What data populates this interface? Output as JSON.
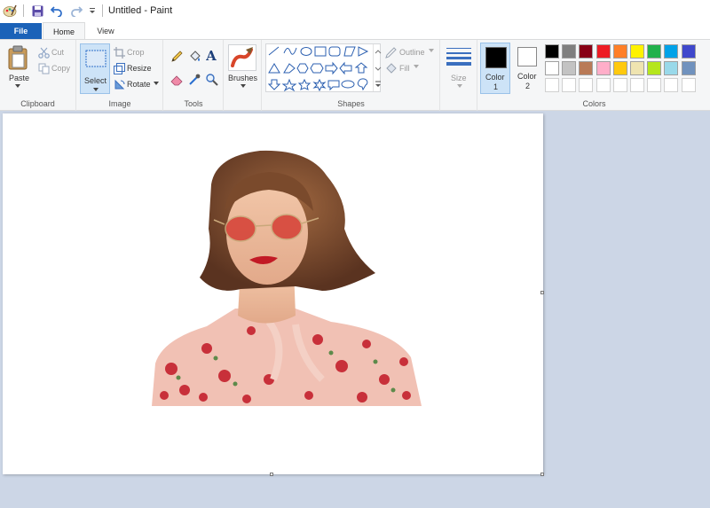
{
  "window": {
    "title": "Untitled - Paint"
  },
  "tabs": {
    "file": "File",
    "home": "Home",
    "view": "View"
  },
  "clipboard": {
    "paste": "Paste",
    "cut": "Cut",
    "copy": "Copy",
    "group_label": "Clipboard"
  },
  "image": {
    "select": "Select",
    "crop": "Crop",
    "resize": "Resize",
    "rotate": "Rotate",
    "group_label": "Image"
  },
  "tools": {
    "group_label": "Tools"
  },
  "brushes": {
    "label": "Brushes"
  },
  "shapes": {
    "outline": "Outline",
    "fill": "Fill",
    "group_label": "Shapes"
  },
  "size": {
    "label": "Size"
  },
  "colors": {
    "color1_label": "Color",
    "color1_num": "1",
    "color2_label": "Color",
    "color2_num": "2",
    "group_label": "Colors",
    "color1_value": "#000000",
    "color2_value": "#ffffff",
    "palette_row1": [
      "#000000",
      "#7f7f7f",
      "#880015",
      "#ed1c24",
      "#ff7f27",
      "#fff200",
      "#22b14c",
      "#00a2e8",
      "#3f48cc",
      "#a349a4"
    ],
    "palette_row2": [
      "#ffffff",
      "#c3c3c3",
      "#b97a57",
      "#ffaec9",
      "#ffc90e",
      "#efe4b0",
      "#b5e61d",
      "#99d9ea",
      "#7092be",
      "#c8bfe7"
    ]
  },
  "canvas": {
    "content": "photo-woman-red-sunglasses-floral-blouse"
  }
}
